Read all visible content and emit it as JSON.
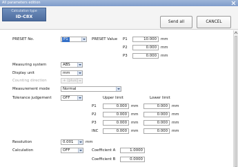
{
  "window": {
    "title": "All parameters edition"
  },
  "toolbar": {
    "calc_type_label": "Calculation type",
    "calc_type_value": "ID-C8X",
    "send_all": "Send all",
    "cancel": "CANCEL"
  },
  "preset": {
    "label": "PRESET No.",
    "number": "P1",
    "value_label": "PRESET Value",
    "rows": [
      {
        "name": "P1",
        "value": "10.000",
        "unit": "mm"
      },
      {
        "name": "P2",
        "value": "0.000",
        "unit": "mm"
      },
      {
        "name": "P3",
        "value": "0.000",
        "unit": "mm"
      }
    ]
  },
  "measuring_system": {
    "label": "Measuring system",
    "value": "ABS"
  },
  "display_unit": {
    "label": "Display unit",
    "value": "mm"
  },
  "counting_direction": {
    "label": "Counting direction",
    "value": "+ (plus)"
  },
  "measurement_mode": {
    "label": "Measurement mode",
    "value": "Normal"
  },
  "tolerance": {
    "label": "Tolerance judgement",
    "value": "OFF",
    "upper_header": "Upper limit",
    "lower_header": "Lower limit",
    "rows": [
      {
        "name": "P1",
        "upper": "0.000",
        "lower": "0.000",
        "unit": "mm"
      },
      {
        "name": "P2",
        "upper": "0.000",
        "lower": "0.000",
        "unit": "mm"
      },
      {
        "name": "P3",
        "upper": "0.000",
        "lower": "0.000",
        "unit": "mm"
      },
      {
        "name": "INC",
        "upper": "0.000",
        "lower": "0.000",
        "unit": "mm"
      }
    ]
  },
  "resolution": {
    "label": "Resolution",
    "value": "0.001",
    "unit": "mm"
  },
  "calculation": {
    "label": "Calculation",
    "value": "OFF",
    "coef_a_label": "Coefficient A",
    "coef_a": "1.0000",
    "coef_b_label": "Coefficient B",
    "coef_b": "0.0000"
  },
  "colors": {
    "title_bar": "#8aa6d1",
    "calc_button": "#5c7cad",
    "selection": "#3470c8"
  },
  "icons": {
    "close": "close-icon",
    "scroll_up": "chevron-up-icon"
  }
}
